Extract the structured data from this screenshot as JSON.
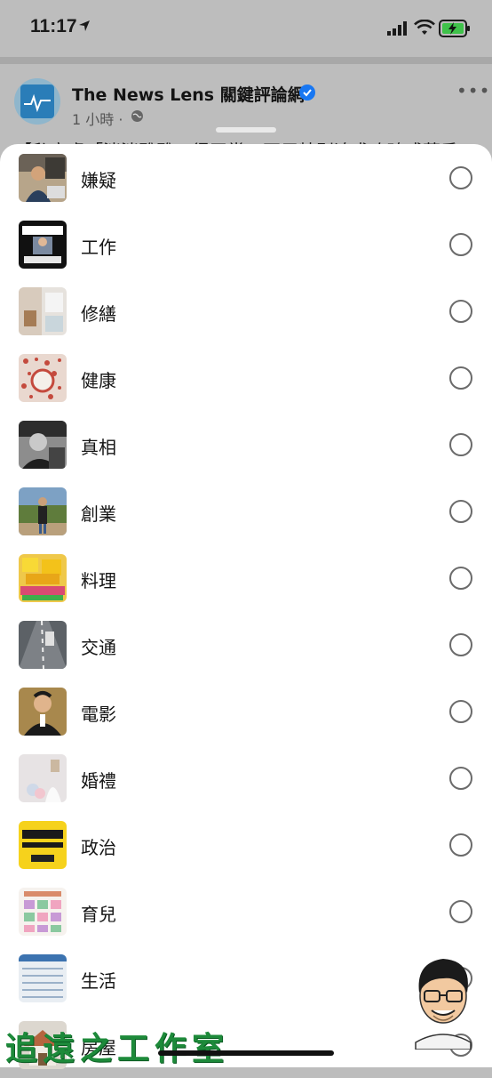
{
  "status_bar": {
    "time": "11:17"
  },
  "post": {
    "page_name": "The News Lens 關鍵評論網",
    "meta_time": "1 小時",
    "meta_sep": "·",
    "more": "•••",
    "snippet": "【私密處「洸洸雅雅」得天常，不用特別追求玫瑰或蒜香"
  },
  "categories": [
    {
      "label": "嫌疑",
      "thumb": "thumb-man-laptop"
    },
    {
      "label": "工作",
      "thumb": "thumb-video-dark"
    },
    {
      "label": "修繕",
      "thumb": "thumb-room"
    },
    {
      "label": "健康",
      "thumb": "thumb-pattern-red"
    },
    {
      "label": "真相",
      "thumb": "thumb-bw-person"
    },
    {
      "label": "創業",
      "thumb": "thumb-person-outdoor"
    },
    {
      "label": "料理",
      "thumb": "thumb-yellow-food"
    },
    {
      "label": "交通",
      "thumb": "thumb-road"
    },
    {
      "label": "電影",
      "thumb": "thumb-man-suit"
    },
    {
      "label": "婚禮",
      "thumb": "thumb-wedding"
    },
    {
      "label": "政治",
      "thumb": "thumb-yellow-poster"
    },
    {
      "label": "育兒",
      "thumb": "thumb-chart-grid"
    },
    {
      "label": "生活",
      "thumb": "thumb-document"
    },
    {
      "label": "房屋",
      "thumb": "thumb-house"
    }
  ],
  "watermark": "追遠之工作室",
  "colors": {
    "verified": "#1877f2",
    "watermark": "#1d8a3a"
  }
}
